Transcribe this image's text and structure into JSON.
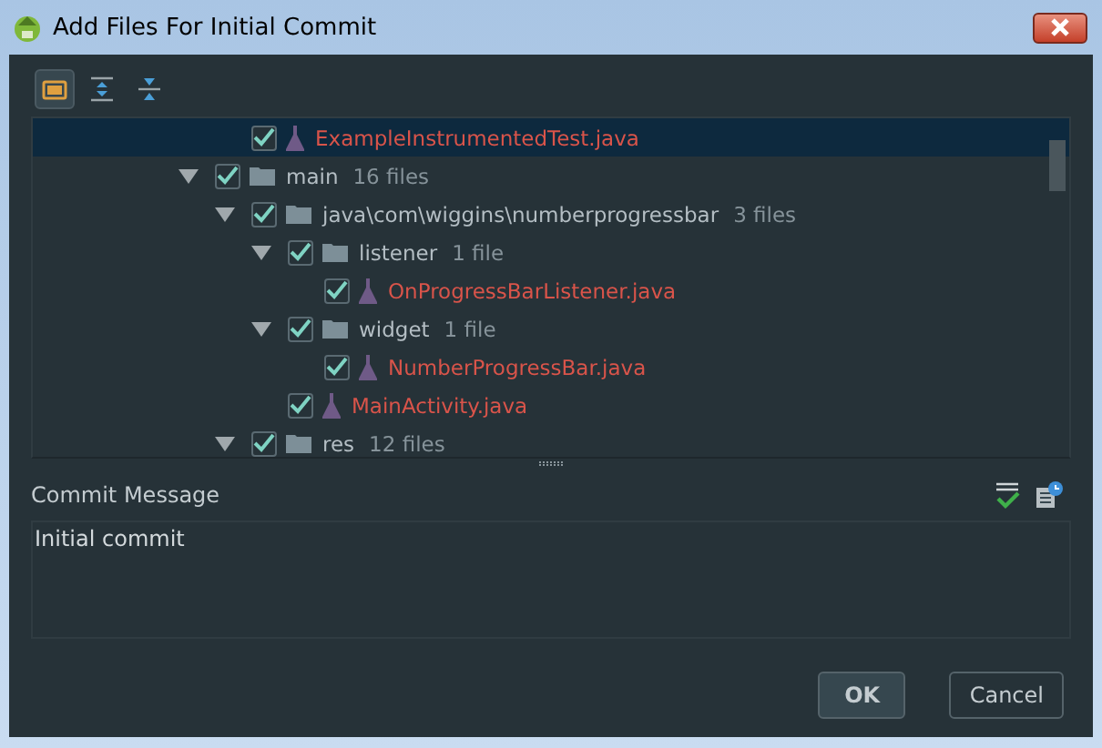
{
  "window": {
    "title": "Add Files For Initial Commit"
  },
  "toolbar": [
    {
      "kind": "group",
      "selected": true
    },
    {
      "kind": "expand",
      "selected": false
    },
    {
      "kind": "collapse",
      "selected": false
    }
  ],
  "tree": {
    "partial_branch": [
      {
        "kind": "file",
        "name": "ExampleInstrumentedTest.java",
        "checked": true,
        "selected": true
      }
    ],
    "items": [
      {
        "kind": "folder",
        "name": "main",
        "count": "16 files",
        "checked": true,
        "expanded": true,
        "selected": false,
        "children": [
          {
            "kind": "folder",
            "name": "java\\com\\wiggins\\numberprogressbar",
            "count": "3 files",
            "checked": true,
            "expanded": true,
            "selected": false,
            "children": [
              {
                "kind": "folder",
                "name": "listener",
                "count": "1 file",
                "checked": true,
                "expanded": true,
                "selected": false,
                "children": [
                  {
                    "kind": "file",
                    "name": "OnProgressBarListener.java",
                    "checked": true,
                    "selected": false
                  }
                ]
              },
              {
                "kind": "folder",
                "name": "widget",
                "count": "1 file",
                "checked": true,
                "expanded": true,
                "selected": false,
                "children": [
                  {
                    "kind": "file",
                    "name": "NumberProgressBar.java",
                    "checked": true,
                    "selected": false
                  }
                ]
              },
              {
                "kind": "file",
                "name": "MainActivity.java",
                "checked": true,
                "selected": false
              }
            ]
          },
          {
            "kind": "folder",
            "name": "res",
            "count": "12 files",
            "checked": true,
            "expanded": true,
            "selected": false
          }
        ]
      }
    ]
  },
  "commit": {
    "label": "Commit Message",
    "value": "Initial commit"
  },
  "buttons": [
    {
      "label": "OK",
      "default": true
    },
    {
      "label": "Cancel",
      "default": false
    }
  ]
}
